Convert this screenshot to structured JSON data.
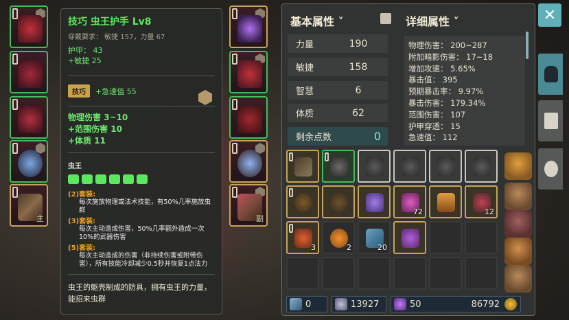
{
  "tooltip": {
    "title": "技巧  虫王护手  Lv8",
    "requirement": "穿戴要求：  敏捷 157，力量 67",
    "base_stats": [
      "护甲：  43",
      "+敏捷  25"
    ],
    "skill_tag": "技巧",
    "skill_text": "+急速值  55",
    "sub_stats": [
      "物理伤害  3~10",
      "+范围伤害  10",
      "+体质  11"
    ],
    "set_name": "虫王",
    "set_bonuses": [
      {
        "label": "(2)套装:",
        "desc": "每次施放物理或法术技能，有50%几率施放虫群"
      },
      {
        "label": "(3)套装:",
        "desc": "每次主动造成伤害，50%几率额外造成一次10%的武器伤害"
      },
      {
        "label": "(5)套装:",
        "desc": "每次主动造成的伤害（非持续伤害或附带伤害），所有技能冷却减少0.5秒并恢复1点法力"
      }
    ],
    "flavor": "虫王的躯壳制成的防具，拥有虫王的力量，能招来虫群"
  },
  "equipment": {
    "left_slot_tag": "主",
    "right_slot_tag": "副"
  },
  "panel": {
    "basic_title": "基本属性",
    "detail_title": "详细属性",
    "attributes": [
      {
        "name": "力量",
        "value": "190"
      },
      {
        "name": "敏捷",
        "value": "158"
      },
      {
        "name": "智慧",
        "value": "6"
      },
      {
        "name": "体质",
        "value": "62"
      }
    ],
    "points_label": "剩余点数",
    "points_value": "0",
    "details": [
      "物理伤害：  200~287",
      "附加暗影伤害：  17~18",
      "增加攻速：  5.65%",
      "暴击值：  395",
      "预期暴击率：  9.97%",
      "暴击伤害：  179.34%",
      "范围伤害：  107",
      "护甲穿透：  15",
      "急速值：  112"
    ]
  },
  "inventory": {
    "counts": {
      "amethyst": "72",
      "crown": "12",
      "leaf": "3",
      "pumpkin": "2",
      "scroll": "20"
    }
  },
  "footer": {
    "keys": "0",
    "gems": "13927",
    "crystals": "50",
    "gold": "86792"
  },
  "colors": {
    "set_green": "#6de86d",
    "rarity_gold": "#c9a45a",
    "rarity_green": "#3fbf5a",
    "accent_teal": "#5fb0b8"
  }
}
